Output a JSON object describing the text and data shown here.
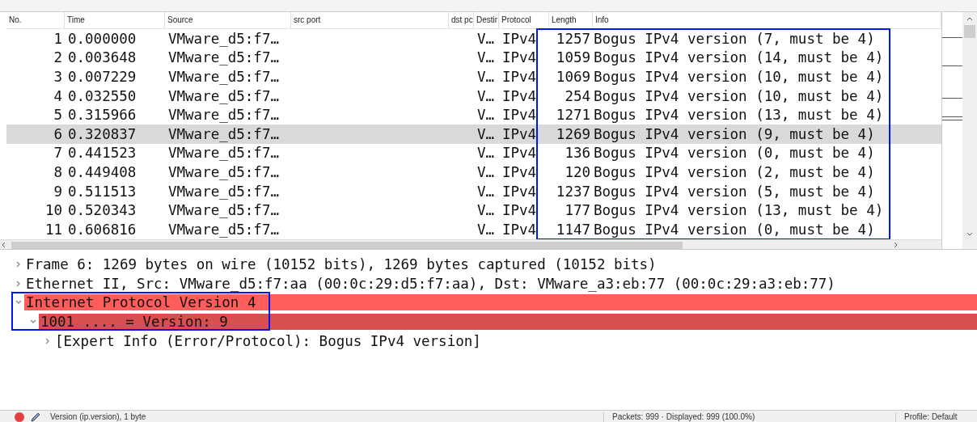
{
  "packet_list": {
    "columns": [
      "No.",
      "Time",
      "Source",
      "src port",
      "dst pc",
      "Destir",
      "Protocol",
      "Length",
      "Info"
    ],
    "rows": [
      {
        "no": "1",
        "time": "0.000000",
        "source": "VMware_d5:f7…",
        "destination": "V…",
        "protocol": "IPv4",
        "length": "1257",
        "info": "Bogus IPv4 version (7, must be 4)",
        "selected": false
      },
      {
        "no": "2",
        "time": "0.003648",
        "source": "VMware_d5:f7…",
        "destination": "V…",
        "protocol": "IPv4",
        "length": "1059",
        "info": "Bogus IPv4 version (14, must be 4)",
        "selected": false
      },
      {
        "no": "3",
        "time": "0.007229",
        "source": "VMware_d5:f7…",
        "destination": "V…",
        "protocol": "IPv4",
        "length": "1069",
        "info": "Bogus IPv4 version (10, must be 4)",
        "selected": false
      },
      {
        "no": "4",
        "time": "0.032550",
        "source": "VMware_d5:f7…",
        "destination": "V…",
        "protocol": "IPv4",
        "length": "254",
        "info": "Bogus IPv4 version (10, must be 4)",
        "selected": false
      },
      {
        "no": "5",
        "time": "0.315966",
        "source": "VMware_d5:f7…",
        "destination": "V…",
        "protocol": "IPv4",
        "length": "1271",
        "info": "Bogus IPv4 version (13, must be 4)",
        "selected": false
      },
      {
        "no": "6",
        "time": "0.320837",
        "source": "VMware_d5:f7…",
        "destination": "V…",
        "protocol": "IPv4",
        "length": "1269",
        "info": "Bogus IPv4 version (9, must be 4)",
        "selected": true
      },
      {
        "no": "7",
        "time": "0.441523",
        "source": "VMware_d5:f7…",
        "destination": "V…",
        "protocol": "IPv4",
        "length": "136",
        "info": "Bogus IPv4 version (0, must be 4)",
        "selected": false
      },
      {
        "no": "8",
        "time": "0.449408",
        "source": "VMware_d5:f7…",
        "destination": "V…",
        "protocol": "IPv4",
        "length": "120",
        "info": "Bogus IPv4 version (2, must be 4)",
        "selected": false
      },
      {
        "no": "9",
        "time": "0.511513",
        "source": "VMware_d5:f7…",
        "destination": "V…",
        "protocol": "IPv4",
        "length": "1237",
        "info": "Bogus IPv4 version (5, must be 4)",
        "selected": false
      },
      {
        "no": "10",
        "time": "0.520343",
        "source": "VMware_d5:f7…",
        "destination": "V…",
        "protocol": "IPv4",
        "length": "177",
        "info": "Bogus IPv4 version (13, must be 4)",
        "selected": false
      },
      {
        "no": "11",
        "time": "0.606816",
        "source": "VMware_d5:f7…",
        "destination": "V…",
        "protocol": "IPv4",
        "length": "1147",
        "info": "Bogus IPv4 version (0, must be 4)",
        "selected": false
      }
    ]
  },
  "packet_details": [
    {
      "text": "Frame 6: 1269 bytes on wire (10152 bits), 1269 bytes captured (10152 bits)",
      "expanded": false,
      "error": false,
      "selected": false
    },
    {
      "text": "Ethernet II, Src: VMware_d5:f7:aa (00:0c:29:d5:f7:aa), Dst: VMware_a3:eb:77 (00:0c:29:a3:eb:77)",
      "expanded": false,
      "error": false,
      "selected": false
    },
    {
      "text": "Internet Protocol Version 4",
      "expanded": true,
      "error": true,
      "selected": false,
      "children": [
        {
          "text": "1001 .... = Version: 9",
          "expanded": true,
          "error": true,
          "selected": true,
          "children": [
            {
              "text": "[Expert Info (Error/Protocol): Bogus IPv4 version]",
              "expanded": false,
              "error": false,
              "selected": false
            }
          ]
        }
      ]
    }
  ],
  "status_bar": {
    "field": "Version (ip.version), 1 byte",
    "packets": "Packets: 999 · Displayed: 999 (100.0%)",
    "profile": "Profile: Default"
  }
}
